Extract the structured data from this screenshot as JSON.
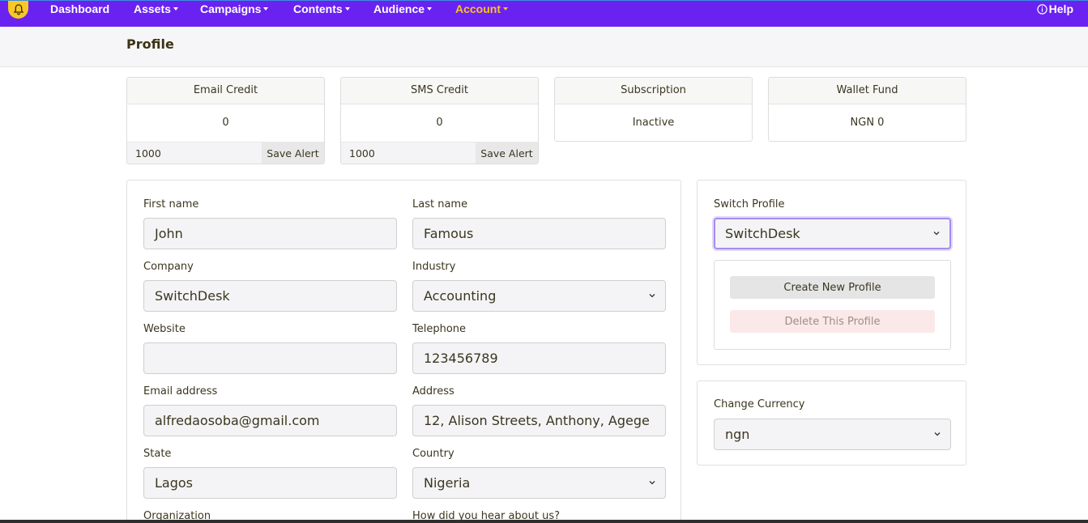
{
  "nav": {
    "items": [
      "Dashboard",
      "Assets",
      "Campaigns",
      "Contents",
      "Audience",
      "Account"
    ],
    "help": "Help",
    "accent": "#6a22f1",
    "active_color": "#f7c229"
  },
  "page": {
    "title": "Profile"
  },
  "stats": {
    "email_credit": {
      "title": "Email Credit",
      "value": "0",
      "alert_value": "1000",
      "alert_button": "Save Alert"
    },
    "sms_credit": {
      "title": "SMS Credit",
      "value": "0",
      "alert_value": "1000",
      "alert_button": "Save Alert"
    },
    "subscription": {
      "title": "Subscription",
      "value": "Inactive"
    },
    "wallet": {
      "title": "Wallet Fund",
      "value": "NGN 0"
    }
  },
  "form": {
    "first_name": {
      "label": "First name",
      "value": "John"
    },
    "last_name": {
      "label": "Last name",
      "value": "Famous"
    },
    "company": {
      "label": "Company",
      "value": "SwitchDesk"
    },
    "industry": {
      "label": "Industry",
      "value": "Accounting"
    },
    "website": {
      "label": "Website",
      "value": ""
    },
    "telephone": {
      "label": "Telephone",
      "value": "123456789"
    },
    "email": {
      "label": "Email address",
      "value": "alfredaosoba@gmail.com"
    },
    "address": {
      "label": "Address",
      "value": "12, Alison Streets, Anthony, Agege"
    },
    "state": {
      "label": "State",
      "value": "Lagos"
    },
    "country": {
      "label": "Country",
      "value": "Nigeria"
    },
    "organization": {
      "label": "Organization"
    },
    "heard_about": {
      "label": "How did you hear about us?"
    }
  },
  "switch_profile": {
    "label": "Switch Profile",
    "selected": "SwitchDesk",
    "create_button": "Create New Profile",
    "delete_button": "Delete This Profile"
  },
  "currency": {
    "label": "Change Currency",
    "selected": "ngn"
  }
}
